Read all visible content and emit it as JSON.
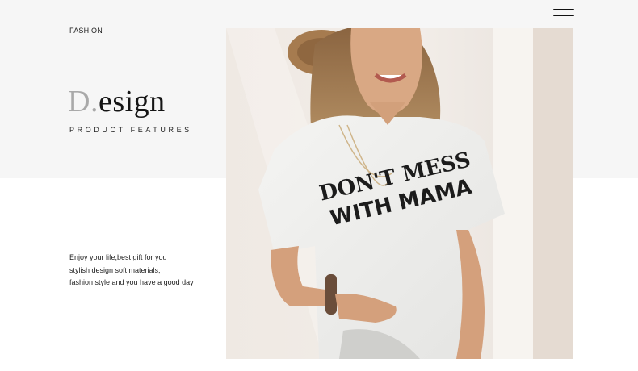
{
  "header": {
    "section_label": "FASHION",
    "menu_icon": "hamburger-menu-icon"
  },
  "hero": {
    "title_initial": "D.",
    "title_rest": "esign",
    "subtitle": "PRODUCT FEATURES"
  },
  "description": {
    "lines": [
      "Enjoy your life,best gift for you",
      "stylish design soft materials,",
      "fashion style and you have a good day"
    ]
  },
  "product_image": {
    "shirt_print_line1": "DON'T MESS",
    "shirt_print_line2": "WITH MAMA"
  },
  "colors": {
    "top_band": "#f6f6f6",
    "title": "#151515",
    "title_initial": "#a9a9a9",
    "shirt": "#f1f1ef",
    "print": "#1c1c1c"
  }
}
